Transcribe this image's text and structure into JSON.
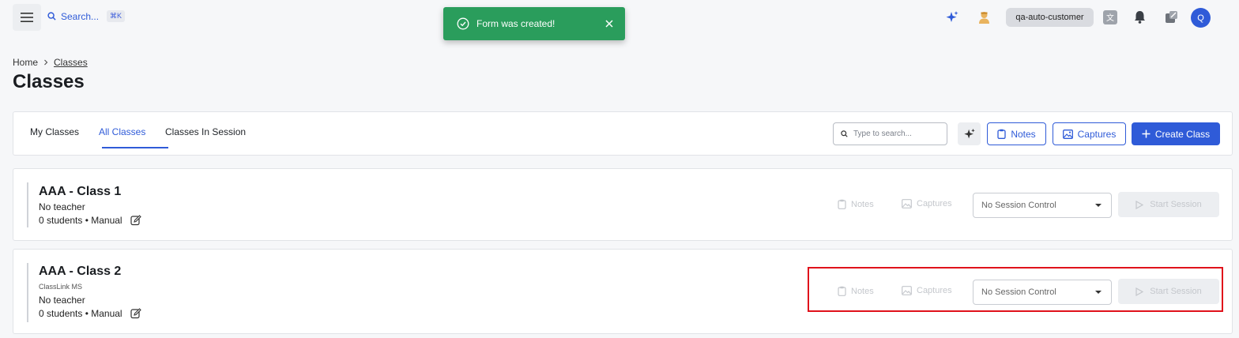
{
  "topbar": {
    "search_label": "Search...",
    "search_shortcut": "⌘K",
    "user_name": "qa-auto-customer",
    "avatar_initial": "Q"
  },
  "toast": {
    "message": "Form was created!",
    "color": "#2a9d5c"
  },
  "breadcrumb": {
    "home": "Home",
    "current": "Classes"
  },
  "page": {
    "title": "Classes"
  },
  "tabs": {
    "items": [
      {
        "label": "My Classes",
        "active": false
      },
      {
        "label": "All Classes",
        "active": true
      },
      {
        "label": "Classes In Session",
        "active": false
      }
    ],
    "search_placeholder": "Type to search...",
    "notes_label": "Notes",
    "captures_label": "Captures",
    "create_label": "Create Class"
  },
  "classes": [
    {
      "title": "AAA - Class 1",
      "subtitle": "",
      "teacher": "No teacher",
      "meta": "0 students • Manual",
      "notes_label": "Notes",
      "captures_label": "Captures",
      "session_control": "No Session Control",
      "start_label": "Start Session"
    },
    {
      "title": "AAA - Class 2",
      "subtitle": "ClassLink MS",
      "teacher": "No teacher",
      "meta": "0 students • Manual",
      "notes_label": "Notes",
      "captures_label": "Captures",
      "session_control": "No Session Control",
      "start_label": "Start Session"
    }
  ],
  "colors": {
    "accent": "#2f5bd8",
    "highlight": "#e0121b"
  }
}
